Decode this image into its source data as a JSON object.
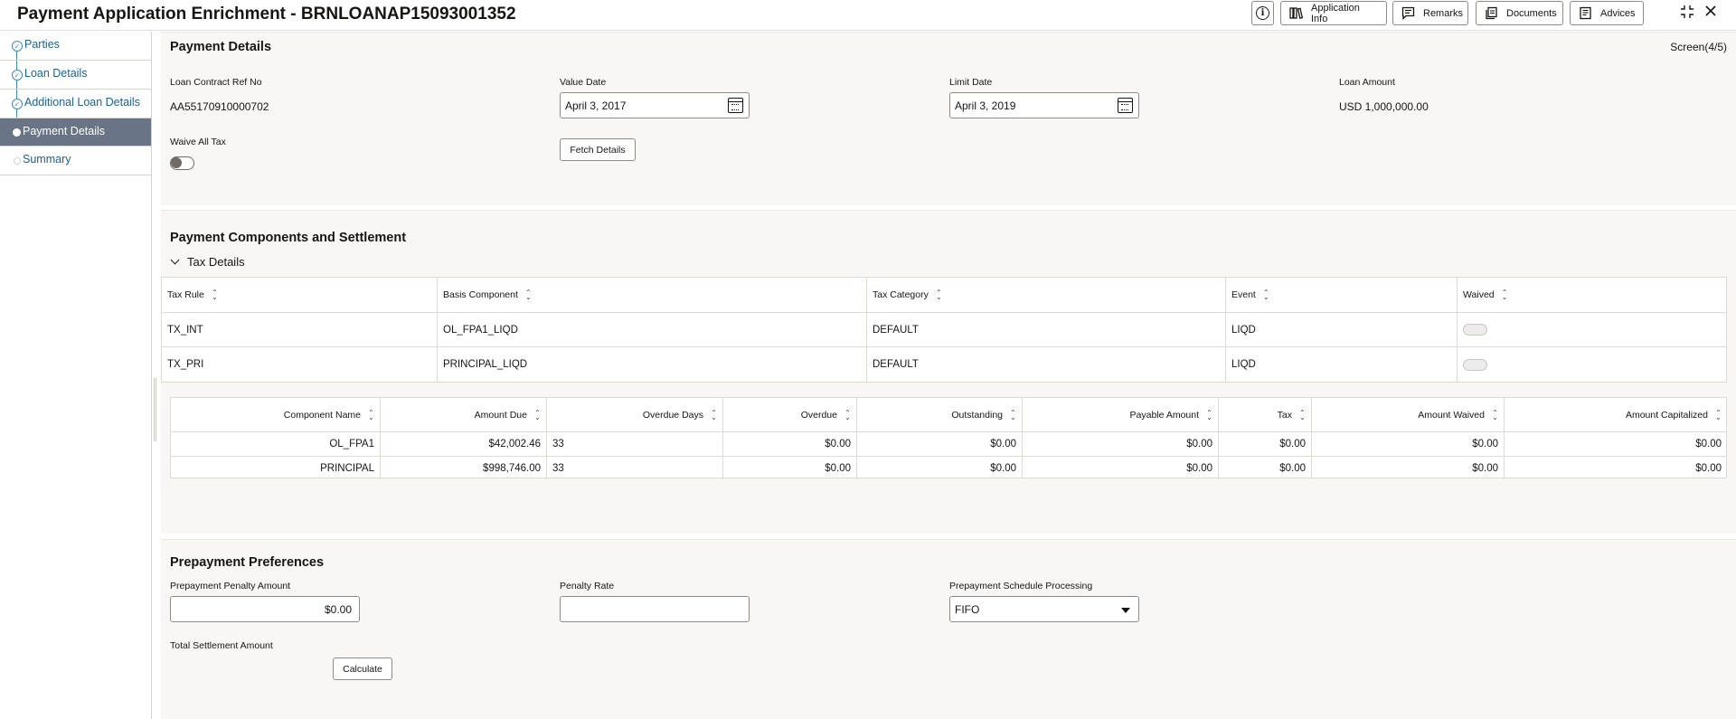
{
  "header": {
    "title": "Payment Application Enrichment - BRNLOANAP15093001352",
    "buttons": {
      "info": "i",
      "application_info": "Application Info",
      "remarks": "Remarks",
      "documents": "Documents",
      "advices": "Advices"
    },
    "icons": [
      "info-icon",
      "application-info-icon",
      "remarks-icon",
      "documents-icon",
      "advices-icon",
      "collapse-icon",
      "close-icon"
    ]
  },
  "sidebar": {
    "items": [
      {
        "label": "Parties",
        "state": "completed"
      },
      {
        "label": "Loan Details",
        "state": "completed"
      },
      {
        "label": "Additional Loan Details",
        "state": "completed"
      },
      {
        "label": "Payment Details",
        "state": "active"
      },
      {
        "label": "Summary",
        "state": "pending"
      }
    ]
  },
  "payment_details": {
    "title": "Payment Details",
    "screen": "Screen(4/5)",
    "loan_contract_ref_label": "Loan Contract Ref No",
    "loan_contract_ref_value": "AA55170910000702",
    "value_date_label": "Value Date",
    "value_date": "April 3, 2017",
    "limit_date_label": "Limit Date",
    "limit_date": "April 3, 2019",
    "loan_amount_label": "Loan Amount",
    "loan_amount": "USD 1,000,000.00",
    "waive_all_tax_label": "Waive All Tax",
    "waive_all_tax": false,
    "fetch_details": "Fetch Details"
  },
  "components": {
    "title": "Payment Components and Settlement",
    "tax_details_label": "Tax Details",
    "tax_table": {
      "headers": [
        "Tax Rule",
        "Basis Component",
        "Tax Category",
        "Event",
        "Waived"
      ],
      "rows": [
        [
          "TX_INT",
          "OL_FPA1_LIQD",
          "DEFAULT",
          "LIQD"
        ],
        [
          "TX_PRI",
          "PRINCIPAL_LIQD",
          "DEFAULT",
          "LIQD"
        ]
      ]
    },
    "component_table": {
      "headers": [
        "Component Name",
        "Amount Due",
        "Overdue Days",
        "Overdue",
        "Outstanding",
        "Payable Amount",
        "Tax",
        "Amount Waived",
        "Amount Capitalized"
      ],
      "rows": [
        [
          "OL_FPA1",
          "$42,002.46",
          "33",
          "$0.00",
          "$0.00",
          "$0.00",
          "$0.00",
          "$0.00",
          "$0.00"
        ],
        [
          "PRINCIPAL",
          "$998,746.00",
          "33",
          "$0.00",
          "$0.00",
          "$0.00",
          "$0.00",
          "$0.00",
          "$0.00"
        ]
      ]
    }
  },
  "prepayment": {
    "title": "Prepayment Preferences",
    "penalty_amount_label": "Prepayment Penalty Amount",
    "penalty_amount": "$0.00",
    "penalty_rate_label": "Penalty Rate",
    "penalty_rate": "",
    "schedule_processing_label": "Prepayment Schedule Processing",
    "schedule_processing": "FIFO",
    "total_settlement_label": "Total Settlement Amount",
    "calculate": "Calculate"
  }
}
